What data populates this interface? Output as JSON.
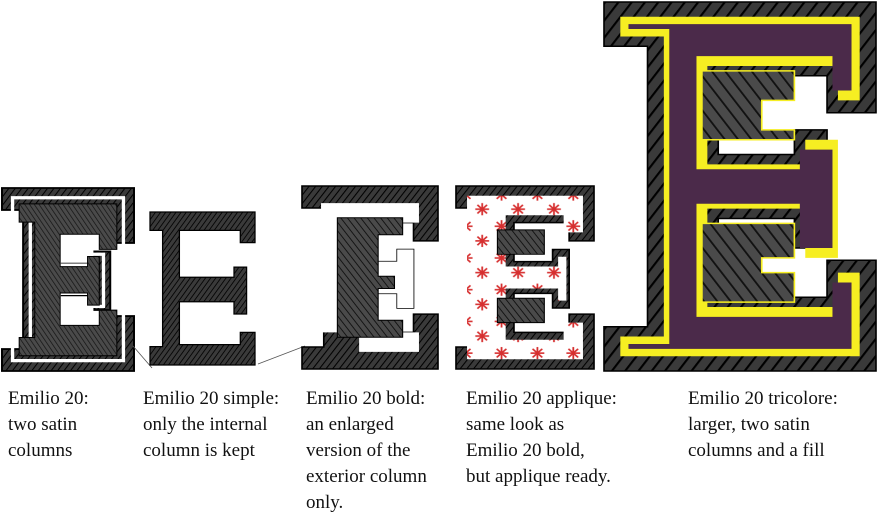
{
  "captions": [
    {
      "text": "Emilio 20:\ntwo satin\ncolumns"
    },
    {
      "text": "Emilio 20 simple:\nonly the internal\ncolumn is kept"
    },
    {
      "text": "Emilio 20 bold:\nan enlarged\nversion of the\nexterior column\nonly."
    },
    {
      "text": "Emilio 20 applique:\nsame look as\nEmilio 20 bold,\nbut applique ready."
    },
    {
      "text": "Emilio 20 tricolore:\nlarger, two satin\ncolumns and a fill"
    }
  ],
  "colors": {
    "stitch": "#2b2b2b",
    "snowflake": "#d62f2f",
    "fill": "#4b2a4a",
    "outline": "#f6ee22"
  },
  "icons": [
    "letter-e-two-satin",
    "letter-e-simple",
    "letter-e-bold",
    "letter-e-applique",
    "letter-e-tricolore"
  ]
}
